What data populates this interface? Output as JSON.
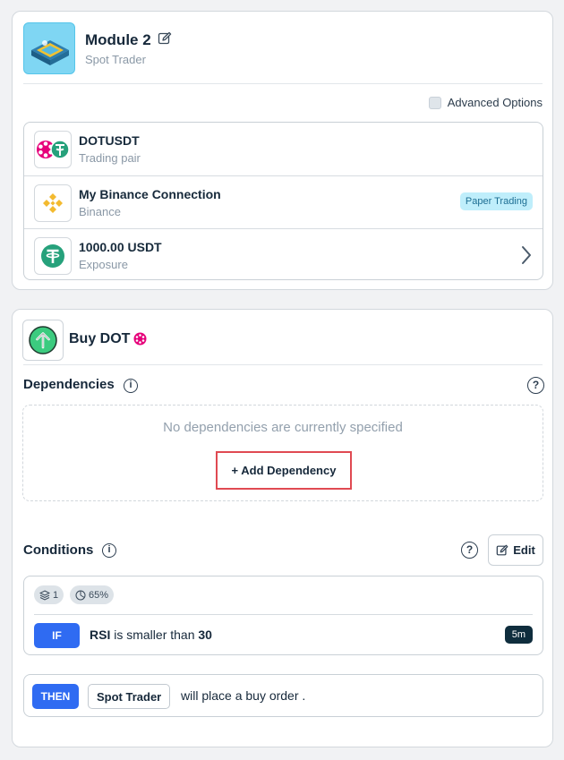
{
  "module": {
    "title": "Module 2",
    "subtitle": "Spot Trader",
    "advanced_label": "Advanced Options",
    "advanced_checked": false
  },
  "summary_rows": [
    {
      "title": "DOTUSDT",
      "subtitle": "Trading pair",
      "icon": "dot-usdt-pair-icon"
    },
    {
      "title": "My Binance Connection",
      "subtitle": "Binance",
      "icon": "binance-icon",
      "badge": "Paper Trading"
    },
    {
      "title": "1000.00 USDT",
      "subtitle": "Exposure",
      "icon": "tether-icon"
    }
  ],
  "action": {
    "title": "Buy DOT",
    "icon": "buy-arrow-up-icon"
  },
  "dependencies": {
    "title": "Dependencies",
    "empty_text": "No dependencies are currently specified",
    "add_label": "+ Add Dependency"
  },
  "conditions": {
    "title": "Conditions",
    "edit_label": "Edit",
    "layers_count": "1",
    "percent": "65%",
    "rule": {
      "if_label": "IF",
      "indicator": "RSI",
      "operator": "is smaller than",
      "value": "30",
      "timeframe": "5m"
    },
    "then": {
      "then_label": "THEN",
      "actor": "Spot Trader",
      "action_text": "will place a buy order ."
    }
  },
  "colors": {
    "accent_blue": "#2f6bf2",
    "paper_badge_bg": "#bfeefb",
    "highlight_red": "#e04a52",
    "timeframe_bg": "#0f2d3d",
    "buy_green": "#3ccb7f",
    "polkadot_pink": "#e6007a",
    "tether_green": "#26a17b",
    "binance_yellow": "#f3ba2f"
  }
}
